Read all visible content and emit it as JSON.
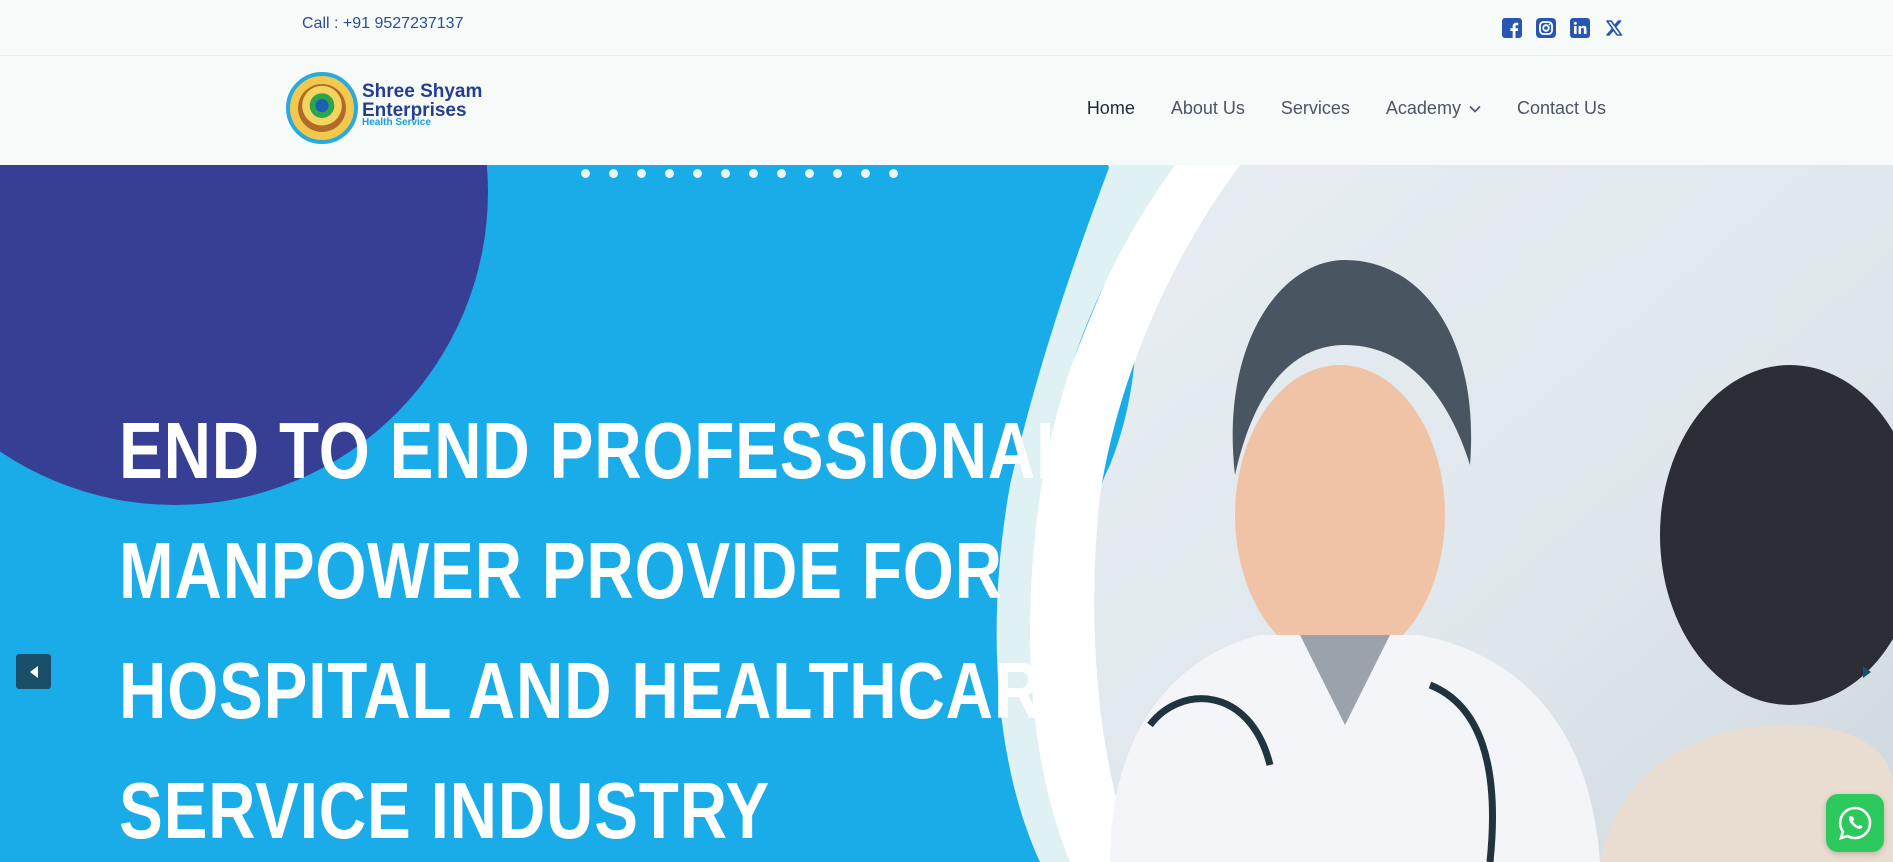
{
  "topbar": {
    "call_text": "Call : +91 9527237137",
    "socials": [
      "facebook-icon",
      "instagram-icon",
      "linkedin-icon",
      "x-twitter-icon"
    ]
  },
  "brand": {
    "name_line1": "Shree Shyam",
    "name_line2": "Enterprises",
    "tagline": "Health Service",
    "emblem_text": "Shree Shyam Enterprises · Health Service"
  },
  "nav": {
    "items": [
      {
        "label": "Home"
      },
      {
        "label": "About Us"
      },
      {
        "label": "Services"
      },
      {
        "label": "Academy"
      },
      {
        "label": "Contact Us"
      }
    ]
  },
  "hero": {
    "headline_lines": [
      "END TO END PROFESSIONAL",
      "MANPOWER PROVIDE FOR",
      "HOSPITAL AND HEALTHCARE",
      "SERVICE INDUSTRY"
    ],
    "slide_dots": 12,
    "prev_icon": "caret-left-icon",
    "next_icon": "caret-right-icon"
  },
  "colors": {
    "brand_blue": "#253e8f",
    "hero_bg": "#1aace9",
    "accent_circle": "#373f94",
    "whatsapp": "#2ec95c"
  },
  "widgets": {
    "whatsapp_icon": "whatsapp-icon"
  }
}
